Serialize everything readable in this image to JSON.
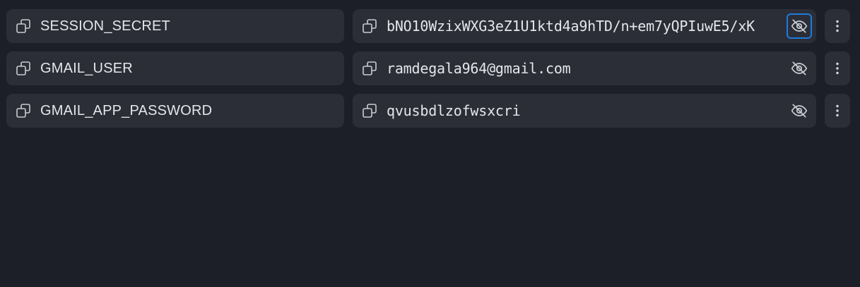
{
  "env_vars": [
    {
      "key": "SESSION_SECRET",
      "value": "bNO10WzixWXG3eZ1U1ktd4a9hTD/n+em7yQPIuwE5/xK",
      "hidden_toggle_focused": true
    },
    {
      "key": "GMAIL_USER",
      "value": "ramdegala964@gmail.com",
      "hidden_toggle_focused": false
    },
    {
      "key": "GMAIL_APP_PASSWORD",
      "value": "qvusbdlzofwsxcri",
      "hidden_toggle_focused": false
    }
  ],
  "icons": {
    "copy": "copy-icon",
    "visibility": "eye-off-icon",
    "menu": "kebab-menu-icon"
  },
  "colors": {
    "background": "#1c1f27",
    "cell": "#2b2e36",
    "text": "#e4e6eb",
    "icon": "#c9ccd3",
    "focus_ring": "#1f7ae0"
  }
}
